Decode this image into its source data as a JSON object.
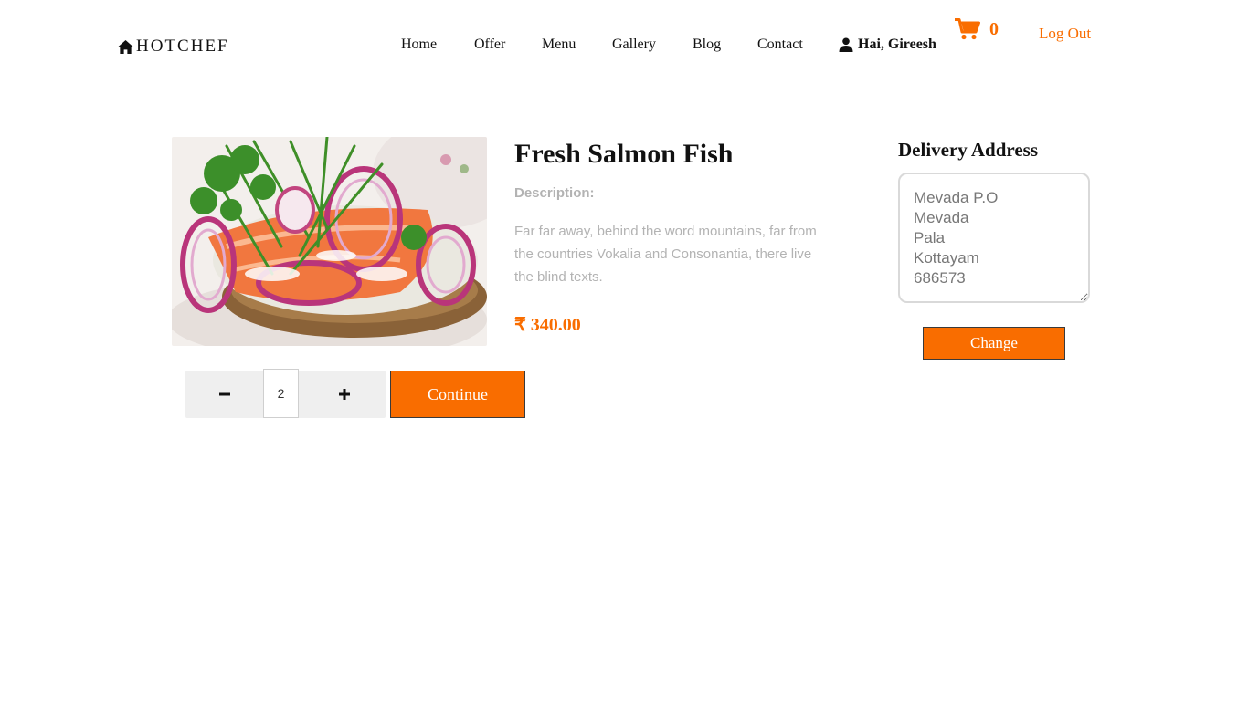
{
  "brand": {
    "name": "HOTCHEF",
    "icon": "home-icon"
  },
  "nav": {
    "items": [
      {
        "label": "Home"
      },
      {
        "label": "Offer"
      },
      {
        "label": "Menu"
      },
      {
        "label": "Gallery"
      },
      {
        "label": "Blog"
      },
      {
        "label": "Contact"
      }
    ],
    "user_greeting": "Hai, Gireesh",
    "user_icon": "user-icon",
    "cart_icon": "cart-icon",
    "cart_count": "0",
    "logout_label": "Log Out"
  },
  "product": {
    "title": "Fresh Salmon Fish",
    "description_label": "Description:",
    "description": "Far far away, behind the word mountains, far from the countries Vokalia and Consonantia, there live the blind texts.",
    "price": "₹ 340.00",
    "image_alt": "Fresh salmon with onion salad",
    "quantity": "2",
    "minus_icon": "minus-icon",
    "plus_icon": "plus-icon",
    "continue_label": "Continue"
  },
  "delivery": {
    "title": "Delivery Address",
    "address": "Mevada P.O\nMevada\nPala\nKottayam\n686573",
    "change_label": "Change"
  },
  "colors": {
    "accent": "#f96d00",
    "text": "#111111",
    "muted": "#b3b3b3",
    "qty_bg": "#efefef"
  }
}
